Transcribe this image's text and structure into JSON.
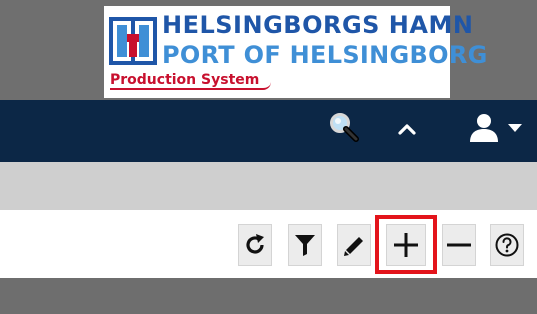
{
  "logo": {
    "line1": "HELSINGBORGS HAMN",
    "line2": "PORT OF HELSINGBORG",
    "line3": "Production System",
    "emblem_icon": "port-emblem-icon",
    "colors": {
      "primary": "#1f56a8",
      "secondary": "#3f8fd6",
      "accent": "#c8102e"
    }
  },
  "navbar": {
    "color": "#0c2746",
    "search_icon": "magnifier-icon",
    "collapse_icon": "chevron-up-icon",
    "user_icon": "user-icon",
    "user_menu_icon": "caret-down-icon"
  },
  "toolbar": {
    "buttons": [
      {
        "name": "refresh",
        "icon": "refresh-icon"
      },
      {
        "name": "filter",
        "icon": "filter-icon"
      },
      {
        "name": "edit",
        "icon": "pencil-icon"
      },
      {
        "name": "add",
        "icon": "plus-icon",
        "highlighted": true
      },
      {
        "name": "remove",
        "icon": "minus-icon"
      },
      {
        "name": "help",
        "icon": "question-circle-icon"
      }
    ],
    "highlight_color": "#e3141b"
  }
}
